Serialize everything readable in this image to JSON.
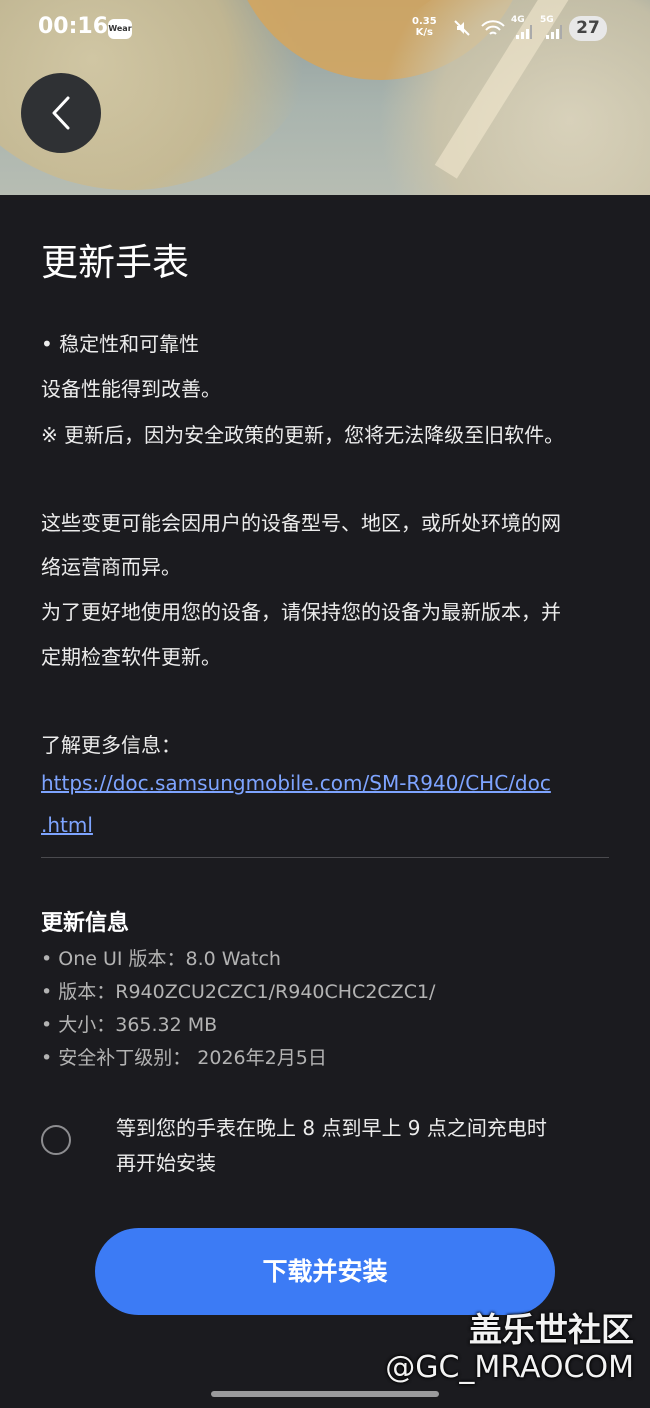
{
  "status_bar": {
    "time": "00:16",
    "wear_badge": "Wear",
    "net_speed_value": "0.35",
    "net_speed_unit": "K/s",
    "signal_4g": "4G",
    "signal_5g": "5G",
    "battery": "27"
  },
  "header": {
    "back_icon": "chevron-left-icon",
    "title": "更新手表"
  },
  "release_notes": {
    "bullet": "• 稳定性和可靠性",
    "line1": "设备性能得到改善。",
    "note": "※ 更新后，因为安全政策的更新，您将无法降级至旧软件。",
    "p2_line1": "这些变更可能会因用户的设备型号、地区，或所处环境的网",
    "p2_line2": "络运营商而异。",
    "p3_line1": "为了更好地使用您的设备，请保持您的设备为最新版本，并",
    "p3_line2": "定期检查软件更新。",
    "more_info_label": "了解更多信息：",
    "link_line1": "https://doc.samsungmobile.com/SM-R940/CHC/doc",
    "link_line2": ".html"
  },
  "update_info": {
    "heading": "更新信息",
    "items": [
      "• One UI 版本：8.0 Watch",
      "• 版本：R940ZCU2CZC1/R940CHC2CZC1/",
      "• 大小：365.32 MB",
      "• 安全补丁级别： 2026年2月5日"
    ]
  },
  "install_option": {
    "line1": "等到您的手表在晚上 8 点到早上 9 点之间充电时",
    "line2": "再开始安装",
    "checked": false
  },
  "actions": {
    "download_install": "下载并安装"
  },
  "watermark": {
    "line1": "盖乐世社区",
    "line2": "@GC_MRAOCOM"
  },
  "colors": {
    "background": "#1b1b1f",
    "accent_button": "#3c7bf5",
    "link": "#7ea4ff"
  }
}
